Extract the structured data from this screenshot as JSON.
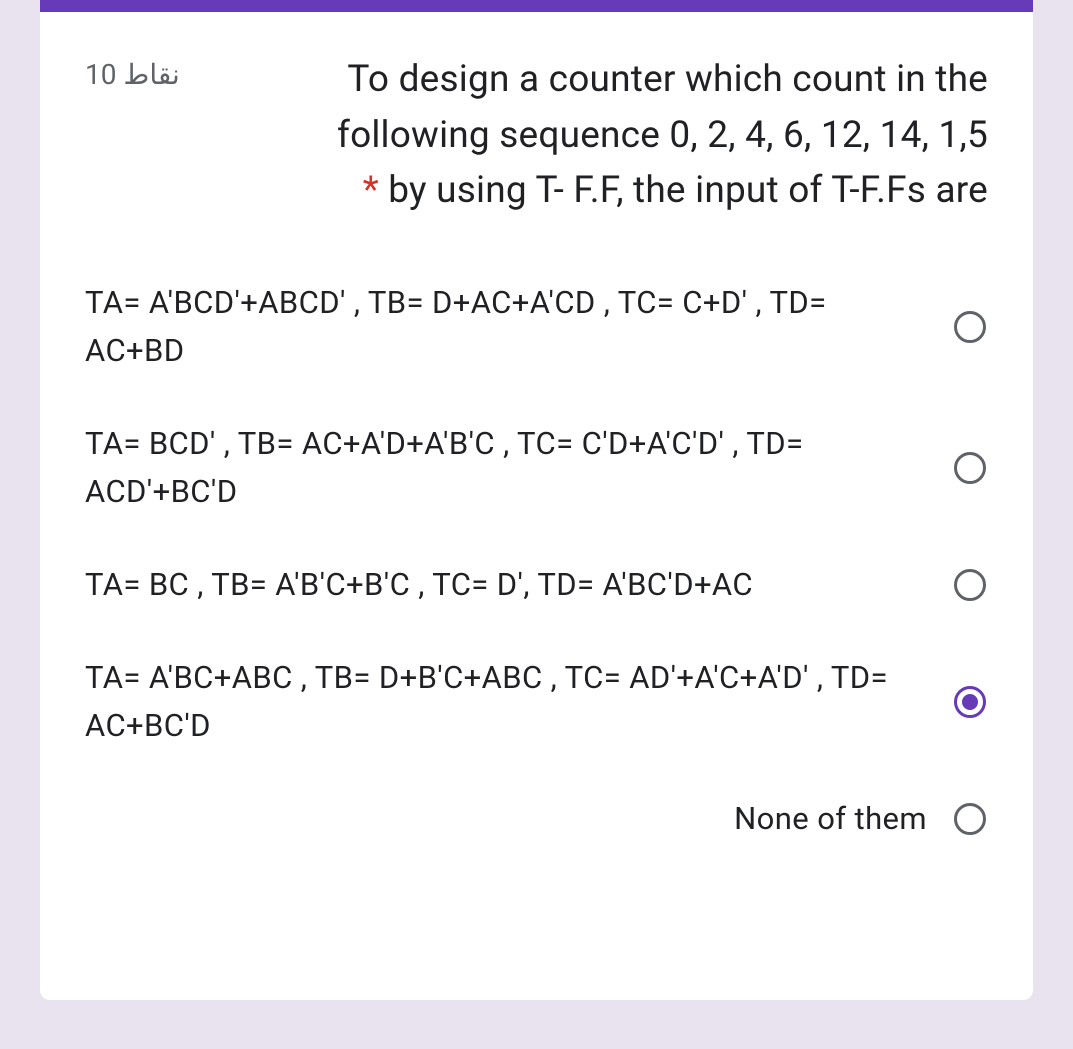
{
  "question": {
    "points_label": "10 نقاط",
    "text_line1": "To design a counter which count in the",
    "text_line2": "following sequence 0, 2, 4, 6, 12, 14, 1,5",
    "text_line3": "by using T- F.F, the input of T-F.Fs are",
    "required_mark": "*"
  },
  "options": [
    {
      "text": "TA= A'BCD'+ABCD' , TB= D+AC+A'CD , TC= C+D' , TD= AC+BD",
      "selected": false
    },
    {
      "text": "TA= BCD' , TB= AC+A'D+A'B'C , TC= C'D+A'C'D' , TD= ACD'+BC'D",
      "selected": false
    },
    {
      "text": "TA= BC , TB= A'B'C+B'C , TC= D', TD= A'BC'D+AC",
      "selected": false
    },
    {
      "text": "TA= A'BC+ABC , TB= D+B'C+ABC , TC= AD'+A'C+A'D' , TD= AC+BC'D",
      "selected": true
    },
    {
      "text": "None of them",
      "selected": false,
      "rtl": true
    }
  ]
}
